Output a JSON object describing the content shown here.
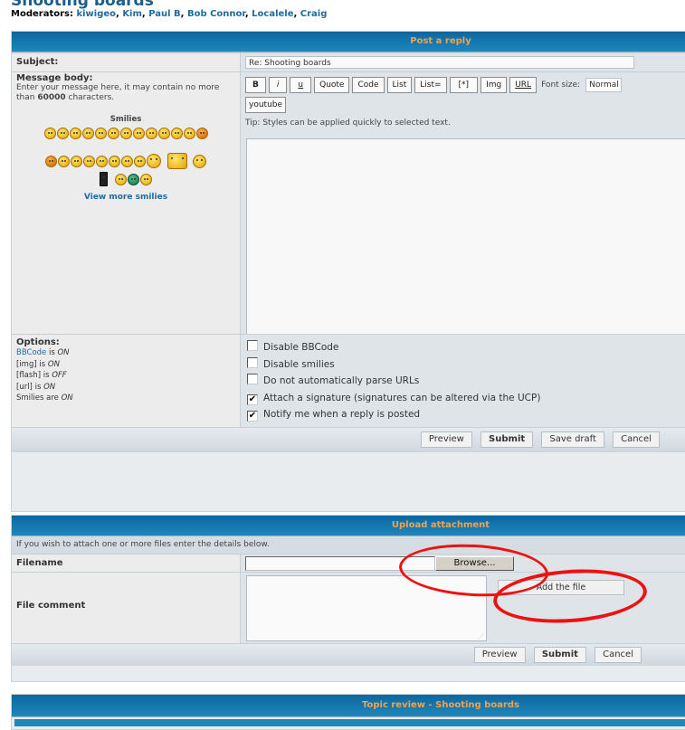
{
  "forum": {
    "title": "Shooting boards",
    "moderators_label": "Moderators:",
    "moderators": [
      "kiwigeo",
      "Kim",
      "Paul B",
      "Bob Connor",
      "Localele",
      "Craig"
    ]
  },
  "post_reply": {
    "header": "Post a reply",
    "subject_label": "Subject:",
    "subject_value": "Re: Shooting boards",
    "message_label": "Message body:",
    "message_explain_prefix": "Enter your message here, it may contain no more than ",
    "message_limit": "60000",
    "message_explain_suffix": " characters.",
    "smilies_title": "Smilies",
    "view_more_smilies": "View more smilies",
    "bbcode_buttons": [
      "B",
      "i",
      "u",
      "Quote",
      "Code",
      "List",
      "List=",
      "[*]",
      "Img",
      "URL"
    ],
    "font_size_label": "Font size:",
    "font_size_value": "Normal",
    "custom_button": "youtube",
    "tip": "Tip: Styles can be applied quickly to selected text.",
    "message_value": "",
    "options_label": "Options:",
    "options_status": [
      {
        "name": "BBCode",
        "link": true,
        "mid": " is ",
        "state": "ON"
      },
      {
        "name": "[img]",
        "link": false,
        "mid": " is ",
        "state": "ON"
      },
      {
        "name": "[flash]",
        "link": false,
        "mid": " is ",
        "state": "OFF"
      },
      {
        "name": "[url]",
        "link": false,
        "mid": " is ",
        "state": "ON"
      },
      {
        "name": "Smilies",
        "link": false,
        "mid": " are ",
        "state": "ON"
      }
    ],
    "checkboxes": [
      {
        "label": "Disable BBCode",
        "checked": false
      },
      {
        "label": "Disable smilies",
        "checked": false
      },
      {
        "label": "Do not automatically parse URLs",
        "checked": false
      },
      {
        "label": "Attach a signature (signatures can be altered via the UCP)",
        "checked": true
      },
      {
        "label": "Notify me when a reply is posted",
        "checked": true
      }
    ],
    "buttons": {
      "preview": "Preview",
      "submit": "Submit",
      "save_draft": "Save draft",
      "cancel": "Cancel"
    }
  },
  "upload": {
    "header": "Upload attachment",
    "intro": "If you wish to attach one or more files enter the details below.",
    "filename_label": "Filename",
    "filename_value": "",
    "browse_button": "Browse...",
    "file_comment_label": "File comment",
    "file_comment_value": "",
    "add_file_button": "Add the file",
    "buttons": {
      "preview": "Preview",
      "submit": "Submit",
      "cancel": "Cancel"
    }
  },
  "topic_review": {
    "header": "Topic review - Shooting boards"
  },
  "colors": {
    "header_bar": "#0b679f",
    "header_text": "#f3a24a",
    "link": "#1e6ba0",
    "annotation": "#ee1111"
  }
}
